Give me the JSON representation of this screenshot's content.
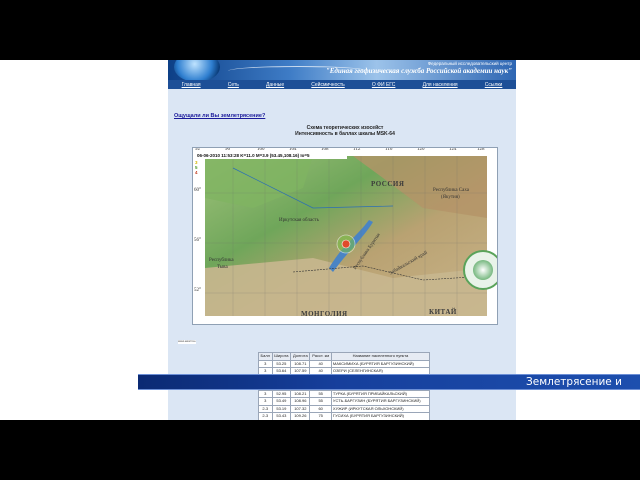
{
  "header": {
    "subtitle": "Федеральный исследовательский центр",
    "title": "\"Единая геофизическая служба Российской академии наук\""
  },
  "nav": [
    "Главная",
    "Сеть",
    "Данные",
    "Сейсмичность",
    "О ФИ ЕГС",
    "Для населения",
    "Ссылки"
  ],
  "question_link": "Ощущали ли Вы землетрясение?",
  "map": {
    "title_line1": "Схема теоретических изосейст",
    "title_line2": "Интенсивность в баллах шкалы MSK-64",
    "event_info": "06-06-2010 11:53:28 K=11.0 M=3.9 (53.45,108.16) Io=5",
    "intensity_scale": [
      "3",
      "5",
      "4"
    ],
    "intensity_colors": [
      "#ffe600",
      "#7ac143",
      "#e04b2a"
    ],
    "lon_labels": [
      "92°",
      "96°",
      "100°",
      "104°",
      "108°",
      "112°",
      "116°",
      "120°",
      "124°",
      "128°"
    ],
    "lat_labels": [
      "60°",
      "56°",
      "52°"
    ],
    "place_labels": {
      "russia": "РОССИЯ",
      "mongolia": "МОНГОЛИЯ",
      "china": "КИТАЙ",
      "irkutsk": "Иркутская область",
      "tuva_1": "Республика",
      "tuva_2": "Тыва",
      "sakha_1": "Республика Саха",
      "sakha_2": "(Якутия)",
      "buryatia": "Республика Бурятия",
      "zabaikal": "Забайкальский край"
    },
    "credit": "www.seismos.ru"
  },
  "table": {
    "headers": [
      "Балл",
      "Широта",
      "Долгота",
      "Расст. км",
      "Название населенного пункта"
    ],
    "rows": [
      [
        "3",
        "53.25",
        "108.71",
        "40",
        "МАКСИМИХА (БУРЯТИЯ БАРГУЗИНСКИЙ)"
      ],
      [
        "3",
        "53.64",
        "107.59",
        "40",
        "ОЗЕРИ (СЕЛЕНГИНСКАЯ)"
      ],
      [
        "",
        "",
        "",
        "",
        ""
      ],
      [
        "",
        "",
        "",
        "",
        ""
      ],
      [
        "3",
        "52.95",
        "108.21",
        "55",
        "ТУРКА (БУРЯТИЯ ПРИБАЙКАЛЬСКИЙ)"
      ],
      [
        "3",
        "53.49",
        "108.96",
        "55",
        "УСТЬ-БАРГУЗИН (БУРЯТИЯ БАРГУЗИНСКИЙ)"
      ],
      [
        "2-3",
        "53.19",
        "107.32",
        "60",
        "ХУЖИР (ИРКУТСКАЯ ОЛЬХОНСКИЙ)"
      ],
      [
        "2-3",
        "53.43",
        "109.26",
        "75",
        "ГУСИХА (БУРЯТИЯ БАРГУЗИНСКИЙ)"
      ]
    ]
  },
  "lower_third": {
    "text": "Землетрясение и"
  }
}
